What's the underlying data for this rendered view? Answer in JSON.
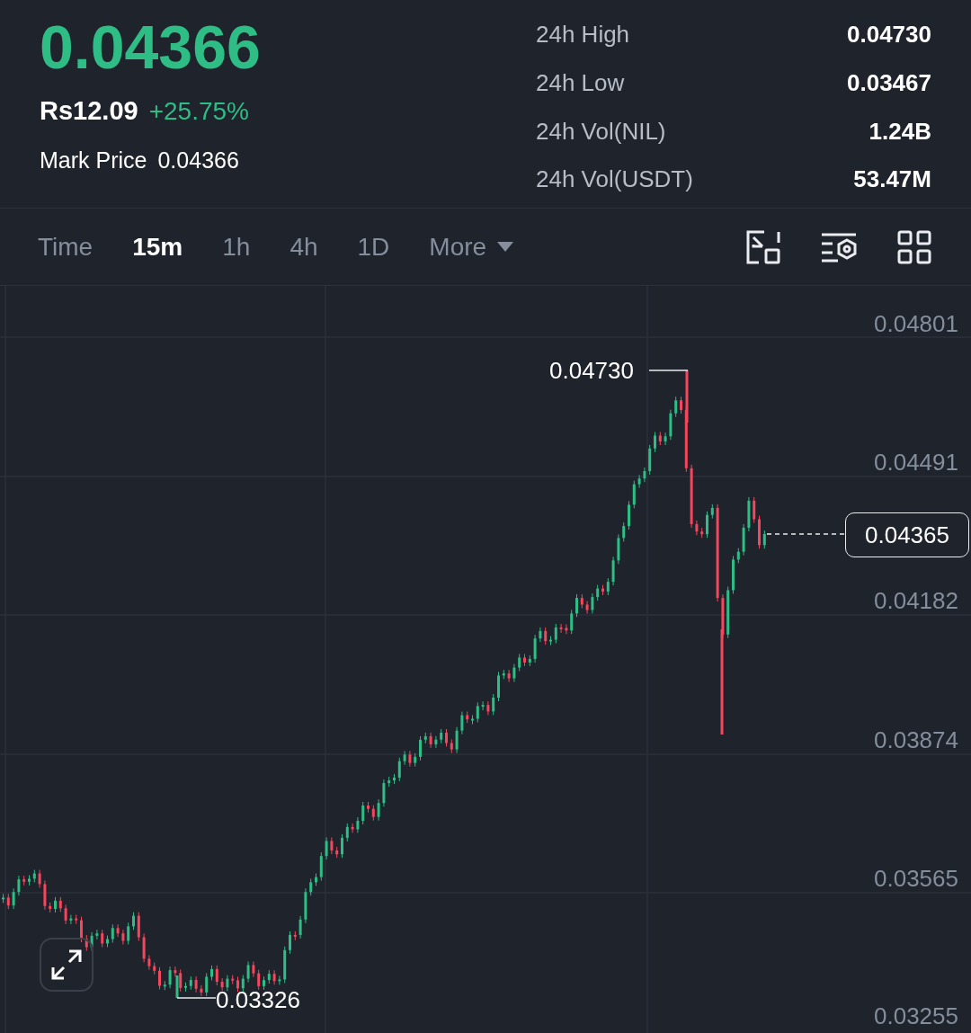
{
  "ticker": {
    "last_price": "0.04366",
    "fiat_price": "Rs12.09",
    "change": "+25.75%",
    "mark_price_label": "Mark Price",
    "mark_price": "0.04366"
  },
  "stats": [
    {
      "label": "24h High",
      "value": "0.04730"
    },
    {
      "label": "24h Low",
      "value": "0.03467"
    },
    {
      "label": "24h Vol(NIL)",
      "value": "1.24B"
    },
    {
      "label": "24h Vol(USDT)",
      "value": "53.47M"
    }
  ],
  "intervals": [
    {
      "label": "Time",
      "selected": false,
      "kind": "interval"
    },
    {
      "label": "15m",
      "selected": true,
      "kind": "interval"
    },
    {
      "label": "1h",
      "selected": false,
      "kind": "interval"
    },
    {
      "label": "4h",
      "selected": false,
      "kind": "interval"
    },
    {
      "label": "1D",
      "selected": false,
      "kind": "interval"
    },
    {
      "label": "More",
      "selected": false,
      "kind": "menu"
    }
  ],
  "chart": {
    "price_axis": [
      "0.04801",
      "0.04491",
      "0.04182",
      "0.03874",
      "0.03565",
      "0.03255"
    ],
    "high_label": "0.04730",
    "low_label": "0.03326",
    "current_price": "0.04365"
  }
}
